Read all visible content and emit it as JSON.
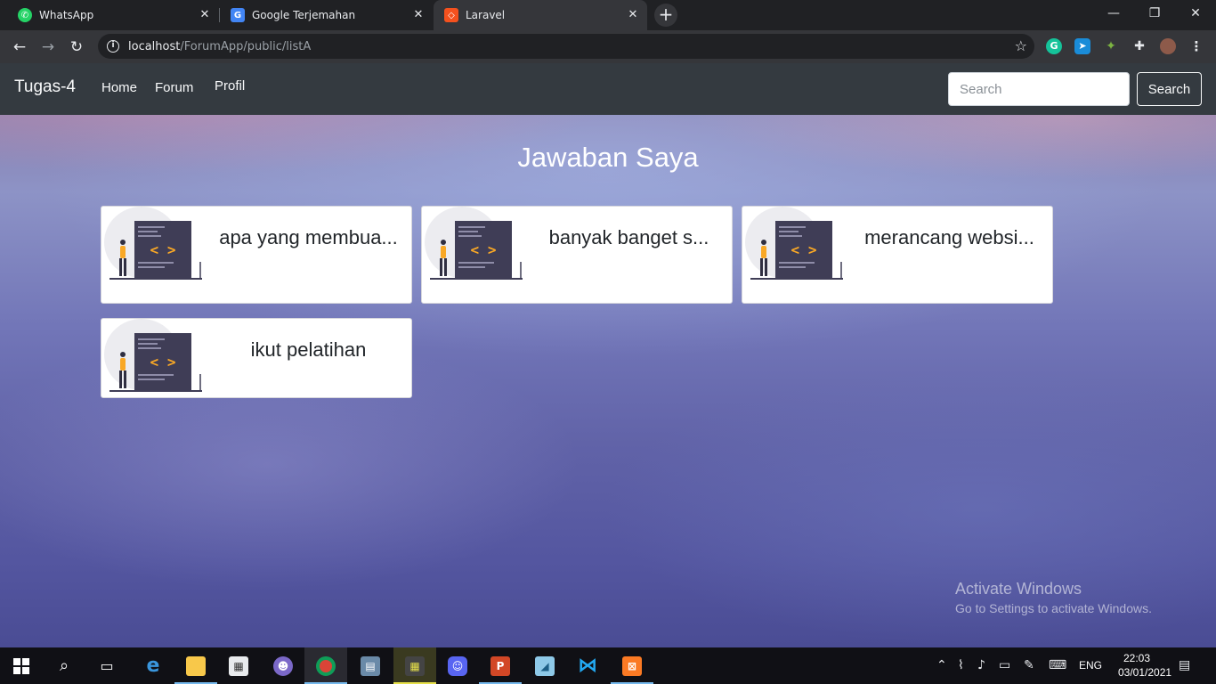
{
  "browser": {
    "tabs": [
      {
        "label": "WhatsApp",
        "icon": "whatsapp-icon",
        "color": "#25d366"
      },
      {
        "label": "Google Terjemahan",
        "icon": "google-translate-icon",
        "color": "#4285f4"
      },
      {
        "label": "Laravel",
        "icon": "laravel-icon",
        "color": "#f4511e"
      }
    ],
    "url_host": "localhost",
    "url_path": "/ForumApp/public/listA"
  },
  "navbar": {
    "brand": "Tugas-4",
    "links": [
      "Home",
      "Forum",
      "Profil"
    ],
    "search_placeholder": "Search",
    "search_button": "Search"
  },
  "page": {
    "heading": "Jawaban Saya",
    "cards": [
      {
        "title": "apa yang membua..."
      },
      {
        "title": "banyak banget s..."
      },
      {
        "title": "merancang websi..."
      },
      {
        "title": "ikut pelatihan"
      }
    ]
  },
  "watermark": {
    "title": "Activate Windows",
    "subtitle": "Go to Settings to activate Windows."
  },
  "taskbar": {
    "language": "ENG",
    "time": "22:03",
    "date": "03/01/2021"
  },
  "colors": {
    "navbar_bg": "#343a40",
    "illustration_accent": "#f9a826",
    "illustration_dark": "#3f3d56"
  }
}
